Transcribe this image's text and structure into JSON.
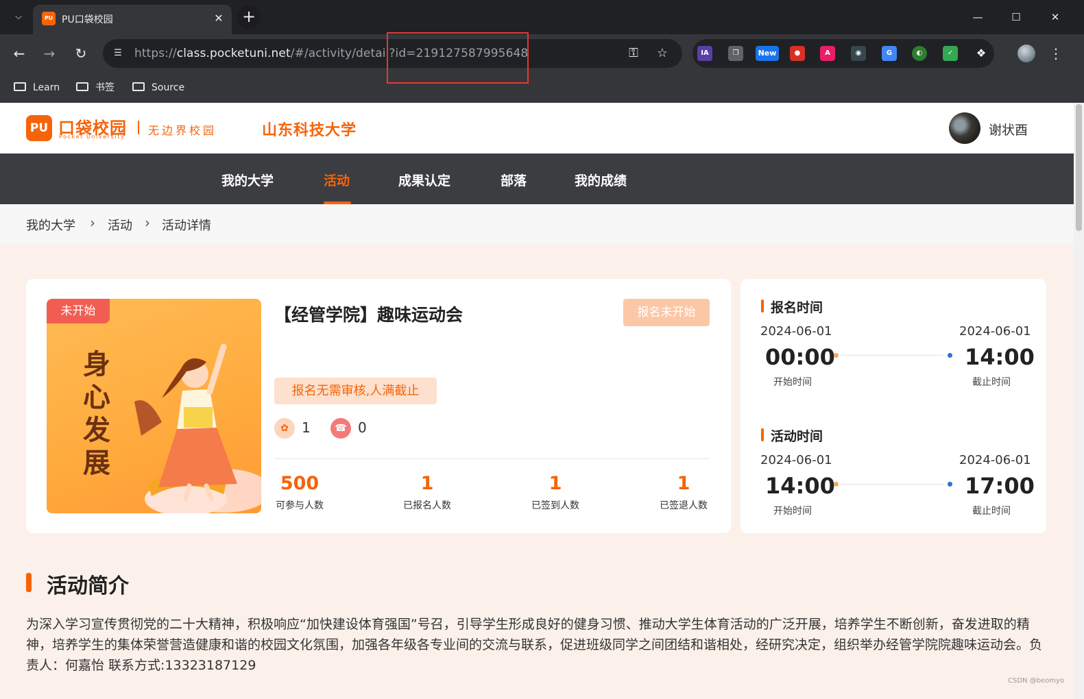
{
  "browser": {
    "tab_title": "PU口袋校园",
    "tab_favicon_text": "PU",
    "url_scheme": "https://",
    "url_host": "class.pocketuni.net",
    "url_path": "/#/activity/detail?id=219127587995648",
    "extension_badge": "New",
    "bookmarks": [
      "Learn",
      "书签",
      "Source"
    ]
  },
  "site": {
    "logo_mark": "PU",
    "logo_name": "口袋校园",
    "logo_sub": "Pocket University",
    "slogan": "无边界校园",
    "school": "山东科技大学",
    "user_name": "谢状酉"
  },
  "nav": {
    "items": [
      "我的大学",
      "活动",
      "成果认定",
      "部落",
      "我的成绩"
    ],
    "active_index": 1
  },
  "breadcrumb": [
    "我的大学",
    "活动",
    "活动详情"
  ],
  "activity": {
    "status_badge": "未开始",
    "cover_text": "身心发展",
    "title": "【经管学院】趣味运动会",
    "signup_button": "报名未开始",
    "rule_tag": "报名无需审核,人满截止",
    "icon_counts": [
      {
        "icon": "badge-icon",
        "value": "1"
      },
      {
        "icon": "phone-icon",
        "value": "0"
      }
    ],
    "stats": [
      {
        "value": "500",
        "label": "可参与人数"
      },
      {
        "value": "1",
        "label": "已报名人数"
      },
      {
        "value": "1",
        "label": "已签到人数"
      },
      {
        "value": "1",
        "label": "已签退人数"
      }
    ]
  },
  "times": {
    "signup": {
      "title": "报名时间",
      "start_date": "2024-06-01",
      "start_time": "00:00",
      "start_caption": "开始时间",
      "end_date": "2024-06-01",
      "end_time": "14:00",
      "end_caption": "截止时间"
    },
    "activity": {
      "title": "活动时间",
      "start_date": "2024-06-01",
      "start_time": "14:00",
      "start_caption": "开始时间",
      "end_date": "2024-06-01",
      "end_time": "17:00",
      "end_caption": "截止时间"
    }
  },
  "intro": {
    "title": "活动简介",
    "text": "为深入学习宣传贯彻党的二十大精神，积极响应“加快建设体育强国”号召，引导学生形成良好的健身习惯、推动大学生体育活动的广泛开展，培养学生不断创新，奋发进取的精神，培养学生的集体荣誉营造健康和谐的校园文化氛围，加强各年级各专业间的交流与联系，促进班级同学之间团结和谐相处，经研究决定，组织举办经管学院院趣味运动会。负责人：何嘉怡 联系方式:13323187129"
  },
  "watermark": "CSDN @beomyo",
  "colors": {
    "brand_orange": "#f5640a",
    "nav_bg": "#3b3d41",
    "page_bg": "#fbf1ea",
    "badge_red": "#f25d52",
    "start_dot": "#f7a45c",
    "end_dot": "#2f6fe0"
  }
}
